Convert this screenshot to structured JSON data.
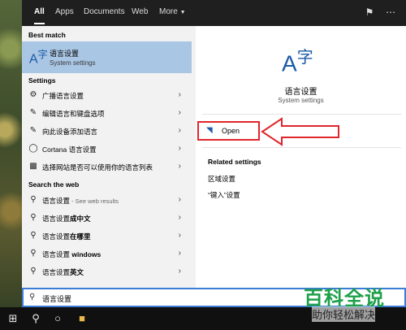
{
  "tabs": [
    "All",
    "Apps",
    "Documents",
    "Web",
    "More"
  ],
  "best_match": {
    "section": "Best match",
    "title": "语言设置",
    "subtitle": "System settings"
  },
  "settings": {
    "section": "Settings",
    "items": [
      "广播语言设置",
      "编辑语言和键盘选项",
      "向此设备添加语言",
      "Cortana 语言设置",
      "选择网站是否可以使用你的语言列表"
    ]
  },
  "web": {
    "section": "Search the web",
    "items": [
      {
        "prefix": "语言设置",
        "bold": "",
        "suffix": " - See web results"
      },
      {
        "prefix": "语言设置",
        "bold": "成中文",
        "suffix": ""
      },
      {
        "prefix": "语言设置",
        "bold": "在哪里",
        "suffix": ""
      },
      {
        "prefix": "语言设置 ",
        "bold": "windows",
        "suffix": ""
      },
      {
        "prefix": "语言设置",
        "bold": "英文",
        "suffix": ""
      }
    ]
  },
  "preview": {
    "title": "语言设置",
    "subtitle": "System settings",
    "open_label": "Open",
    "related_title": "Related settings",
    "related_links": [
      "区域设置",
      "“键入”设置"
    ]
  },
  "search": {
    "value": "语言设置"
  },
  "watermark": {
    "main": "百科全说",
    "sub": "助你轻松解决"
  },
  "icons": {
    "more": "chevron-down-icon",
    "feedback": "feedback-icon",
    "options": "more-options-icon",
    "settings_gear": "gear-icon",
    "broadcast": "broadcast-icon",
    "web": "search-icon"
  },
  "colors": {
    "accent": "#3a7cd6",
    "selection": "#a9c6e4",
    "highlight": "#e0262b",
    "watermark": "#1ea04a"
  }
}
